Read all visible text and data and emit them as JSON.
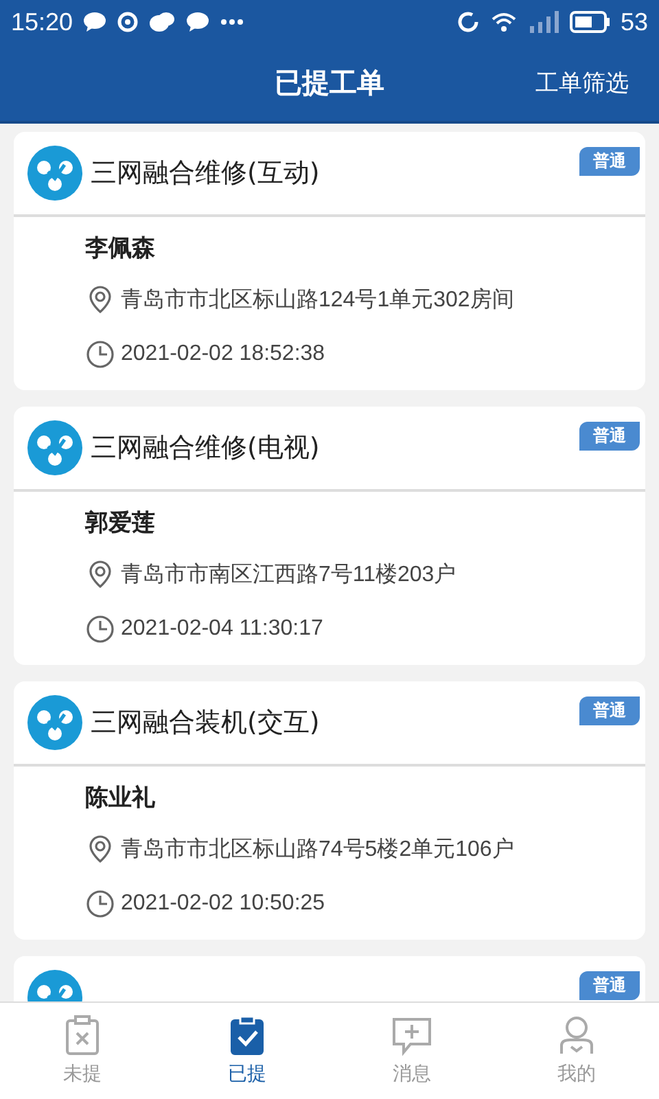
{
  "status_bar": {
    "time": "15:20",
    "battery": "53"
  },
  "header": {
    "title": "已提工单",
    "action": "工单筛选"
  },
  "orders": [
    {
      "title": "三网融合维修(互动)",
      "tag": "普通",
      "name": "李佩森",
      "address": "青岛市市北区标山路124号1单元302房间",
      "time": "2021-02-02 18:52:38"
    },
    {
      "title": "三网融合维修(电视)",
      "tag": "普通",
      "name": "郭爱莲",
      "address": "青岛市市南区江西路7号11楼203户",
      "time": "2021-02-04 11:30:17"
    },
    {
      "title": "三网融合装机(交互)",
      "tag": "普通",
      "name": "陈业礼",
      "address": "青岛市市北区标山路74号5楼2单元106户",
      "time": "2021-02-02 10:50:25"
    },
    {
      "tag": "普通"
    }
  ],
  "tabs": [
    {
      "label": "未提",
      "kind": "pending",
      "selected": false
    },
    {
      "label": "已提",
      "kind": "submitted",
      "selected": true
    },
    {
      "label": "消息",
      "kind": "message",
      "selected": false
    },
    {
      "label": "我的",
      "kind": "profile",
      "selected": false
    }
  ]
}
